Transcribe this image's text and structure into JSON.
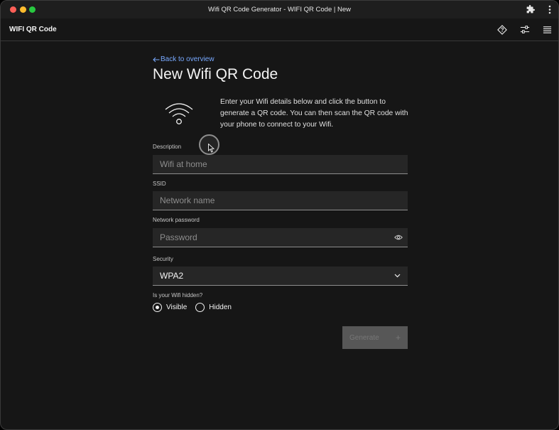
{
  "window": {
    "title": "Wifi QR Code Generator - WIFI QR Code | New"
  },
  "appbar": {
    "app_name": "WIFI QR Code",
    "icons": [
      "help-icon",
      "settings-sliders-icon",
      "menu-icon"
    ]
  },
  "page": {
    "back_label": "Back to overview",
    "title": "New Wifi QR Code",
    "intro": "Enter your Wifi details below and click the button to generate a QR code. You can then scan the QR code with your phone to connect to your Wifi."
  },
  "form": {
    "description": {
      "label": "Description",
      "value": "",
      "placeholder": "Wifi at home"
    },
    "ssid": {
      "label": "SSID",
      "value": "",
      "placeholder": "Network name"
    },
    "password": {
      "label": "Network password",
      "value": "",
      "placeholder": "Password"
    },
    "security": {
      "label": "Security",
      "selected": "WPA2"
    },
    "hidden": {
      "label": "Is your Wifi hidden?",
      "options": [
        {
          "label": "Visible",
          "checked": true
        },
        {
          "label": "Hidden",
          "checked": false
        }
      ]
    },
    "generate_label": "Generate",
    "generate_icon": "+"
  },
  "colors": {
    "background": "#161616",
    "field": "#262626",
    "link": "#78a9ff",
    "button_disabled": "#8d8d8d"
  }
}
